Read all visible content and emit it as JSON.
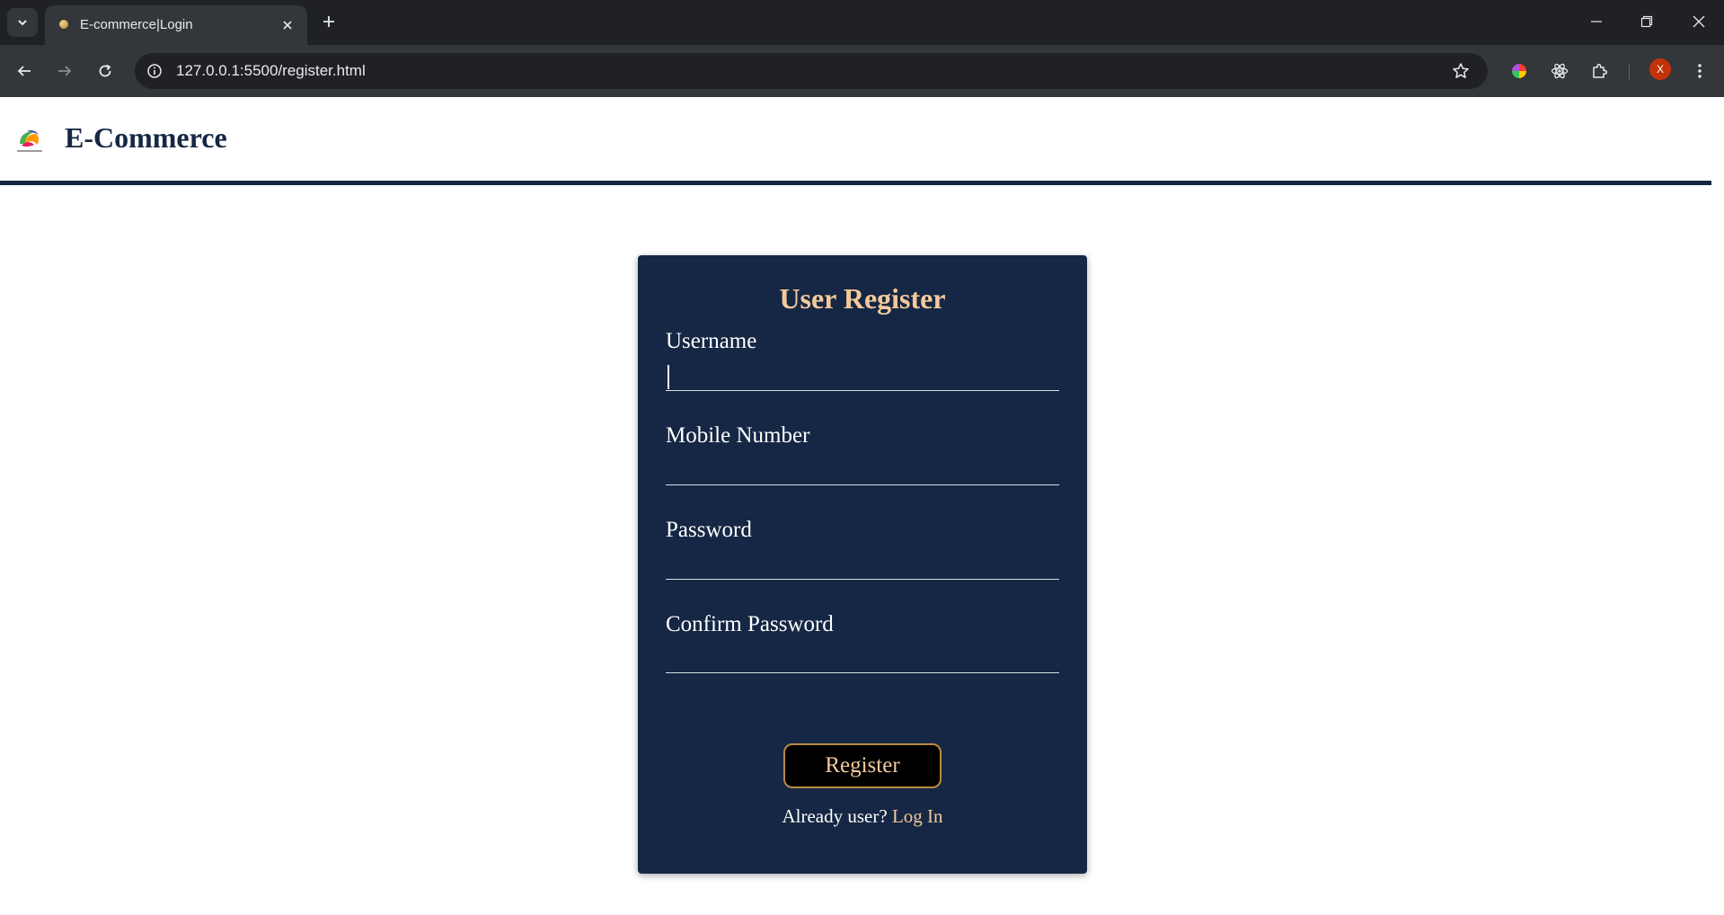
{
  "browser": {
    "tab_title": "E-commerce|Login",
    "url": "127.0.0.1:5500/register.html",
    "profile_initial": "X"
  },
  "site": {
    "brand": "E-Commerce",
    "logo_icon": "colorful-swirl-logo"
  },
  "form": {
    "title": "User Register",
    "fields": [
      {
        "label": "Username",
        "value": "",
        "focused": true
      },
      {
        "label": "Mobile Number",
        "value": ""
      },
      {
        "label": "Password",
        "value": ""
      },
      {
        "label": "Confirm Password",
        "value": ""
      }
    ],
    "submit_label": "Register",
    "already_text": "Already user?",
    "login_link": "Log In"
  },
  "colors": {
    "navy": "#152744",
    "accent_peach": "#f3c99b",
    "button_border": "#b88b3e",
    "chrome_dark": "#1f2125",
    "chrome_mid": "#33363b"
  }
}
